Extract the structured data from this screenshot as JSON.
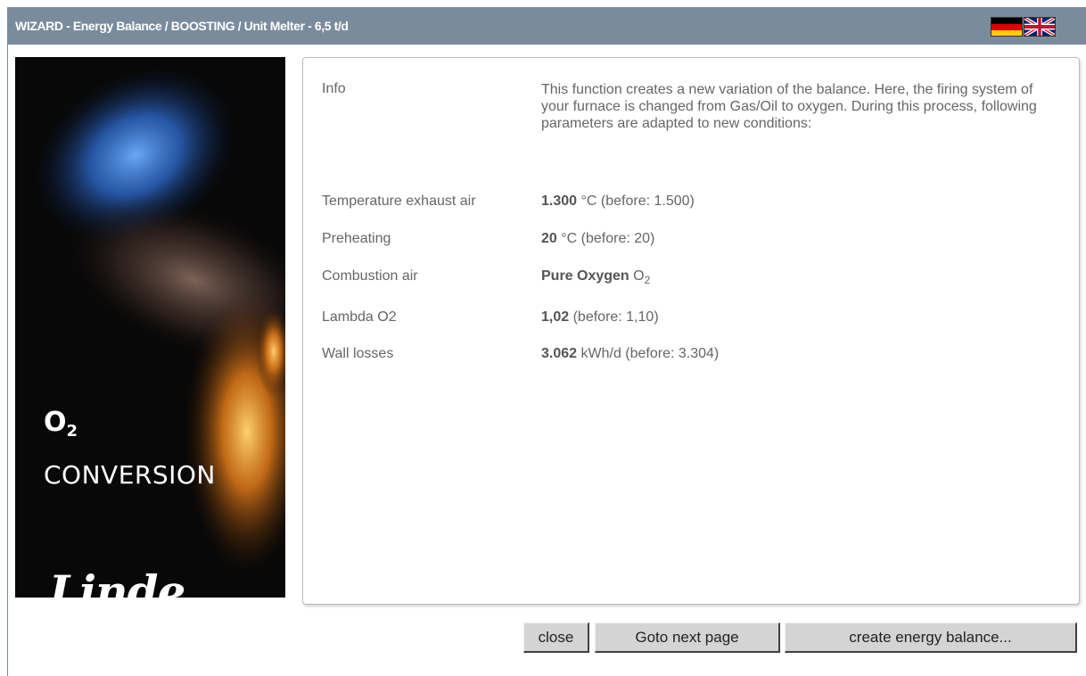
{
  "window": {
    "title": "WIZARD - Energy Balance / BOOSTING / Unit Melter - 6,5 t/d"
  },
  "languages": [
    {
      "name": "German",
      "icon": "german-flag-icon"
    },
    {
      "name": "English",
      "icon": "uk-flag-icon"
    }
  ],
  "sidebar": {
    "o2": "O",
    "o2_sub": "2",
    "conversion": "CONVERSION",
    "brand": "Linde"
  },
  "info": {
    "label": "Info",
    "text": "This function creates a new variation of the balance. Here, the firing system of your furnace is changed from Gas/Oil to oxygen. During this process, following parameters are adapted to new conditions:"
  },
  "parameters": [
    {
      "label": "Temperature exhaust air",
      "value": "1.300",
      "unit": "°C",
      "before": "(before: 1.500)"
    },
    {
      "label": "Preheating",
      "value": "20",
      "unit": "°C",
      "before": "(before: 20)"
    },
    {
      "label": "Combustion air",
      "value": "Pure Oxygen",
      "unit": "O",
      "unit_sub": "2"
    },
    {
      "label": "Lambda O2",
      "value": "1,02",
      "before": "(before: 1,10)"
    },
    {
      "label": "Wall losses",
      "value": "3.062",
      "unit": "kWh/d",
      "before": "(before: 3.304)"
    }
  ],
  "buttons": {
    "close": "close",
    "next": "Goto next page",
    "create": "create energy balance..."
  }
}
